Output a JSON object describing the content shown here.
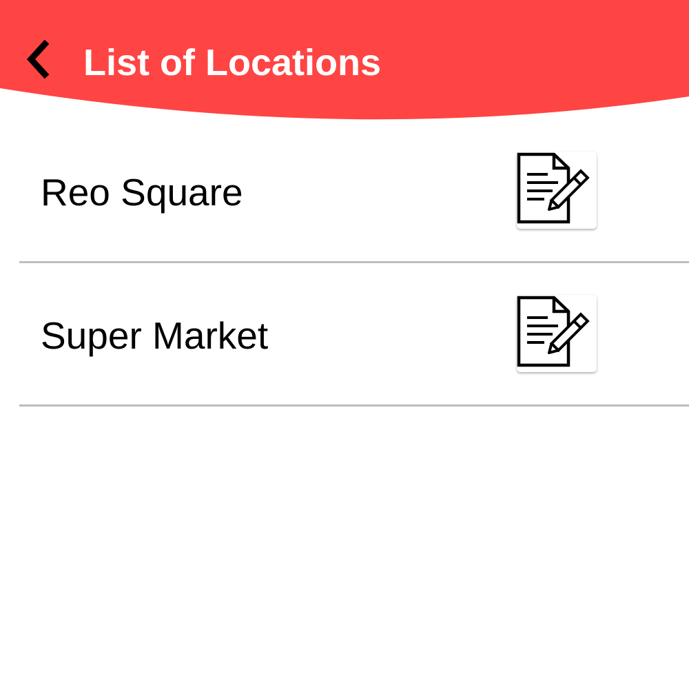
{
  "header": {
    "title": "List of Locations",
    "back_icon": "chevron-left-icon",
    "background_color": "#ff4444",
    "title_color": "#ffffff"
  },
  "locations": [
    {
      "name": "Reo Square",
      "action_icon": "edit-document-icon"
    },
    {
      "name": "Super Market",
      "action_icon": "edit-document-icon"
    }
  ],
  "colors": {
    "divider": "#bdbdbd",
    "text": "#000000",
    "background": "#ffffff"
  }
}
